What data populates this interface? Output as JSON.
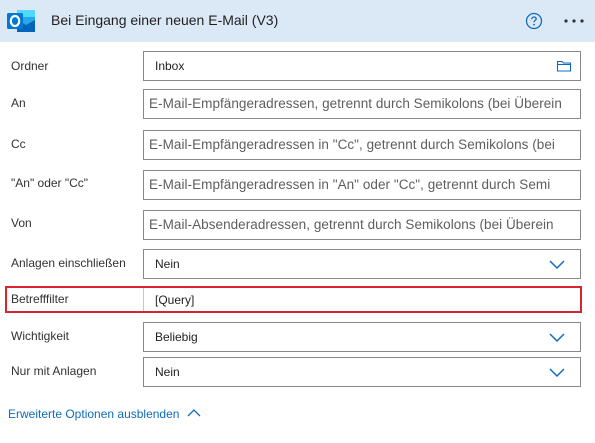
{
  "header": {
    "title": "Bei Eingang einer neuen E-Mail (V3)"
  },
  "fields": [
    {
      "label": "Ordner",
      "value": "Inbox",
      "placeholder": ""
    },
    {
      "label": "An",
      "value": "",
      "placeholder": "E-Mail-Empfängeradressen, getrennt durch Semikolons (bei Überein"
    },
    {
      "label": "Cc",
      "value": "",
      "placeholder": "E-Mail-Empfängeradressen in \"Cc\", getrennt durch Semikolons (bei"
    },
    {
      "label": "\"An\" oder \"Cc\"",
      "value": "",
      "placeholder": "E-Mail-Empfängeradressen in \"An\" oder \"Cc\", getrennt durch Semi"
    },
    {
      "label": "Von",
      "value": "",
      "placeholder": "E-Mail-Absenderadressen, getrennt durch Semikolons (bei Überein"
    },
    {
      "label": "Anlagen einschließen",
      "value": "Nein",
      "placeholder": ""
    },
    {
      "label": "Betrefffilter",
      "value": "[Query]",
      "placeholder": ""
    },
    {
      "label": "Wichtigkeit",
      "value": "Beliebig",
      "placeholder": ""
    },
    {
      "label": "Nur mit Anlagen",
      "value": "Nein",
      "placeholder": ""
    }
  ],
  "footer": {
    "advanced_label": "Erweiterte Optionen ausblenden"
  },
  "colors": {
    "header_bg": "#dbe9f7",
    "accent": "#0f6cbd",
    "highlight": "#d9232e"
  },
  "icons": [
    "outlook-logo",
    "help-icon",
    "more-icon",
    "folder-icon",
    "chevron-down-icon",
    "chevron-up-icon"
  ]
}
